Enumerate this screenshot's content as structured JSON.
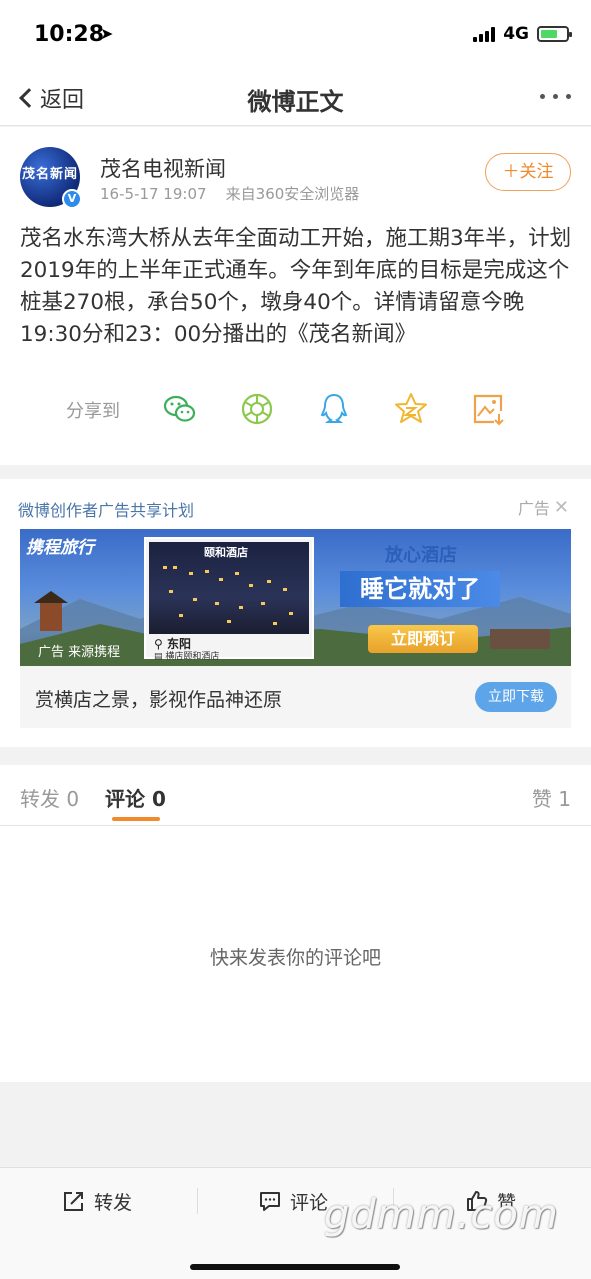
{
  "status_bar": {
    "time": "10:28",
    "network": "4G"
  },
  "nav": {
    "back_label": "返回",
    "title": "微博正文"
  },
  "post": {
    "avatar_text": "茂名新闻",
    "author": "茂名电视新闻",
    "time": "16-5-17 19:07",
    "source": "来自360安全浏览器",
    "follow_label": "＋关注",
    "body": "茂名水东湾大桥从去年全面动工开始，施工期3年半，计划2019年的上半年正式通车。今年到年底的目标是完成这个桩基270根，承台50个，墩身40个。详情请留意今晚19:30分和23：00分播出的《茂名新闻》",
    "share_label": "分享到",
    "share_targets": [
      "wechat-icon",
      "moments-icon",
      "qq-icon",
      "qzone-icon",
      "save-image-icon"
    ]
  },
  "ad": {
    "plan_label": "微博创作者广告共享计划",
    "ad_tag": "广告",
    "banner": {
      "logo": "携程旅行",
      "hotel_sign": "颐和酒店",
      "city": "东阳",
      "hotel_name": "横店颐和酒店",
      "source": "广告 来源携程",
      "heading": "放心酒店",
      "slogan": "睡它就对了",
      "cta": "立即预订"
    },
    "caption": "赏横店之景，影视作品神还原",
    "download_label": "立即下载"
  },
  "comments": {
    "tab_repost": "转发 0",
    "tab_comment": "评论 0",
    "tab_like": "赞 1",
    "empty_text": "快来发表你的评论吧"
  },
  "bottom_bar": {
    "repost": "转发",
    "comment": "评论",
    "like": "赞"
  },
  "colors": {
    "accent": "#f08a2c",
    "link": "#4a76a8",
    "download": "#5ea4e8"
  }
}
